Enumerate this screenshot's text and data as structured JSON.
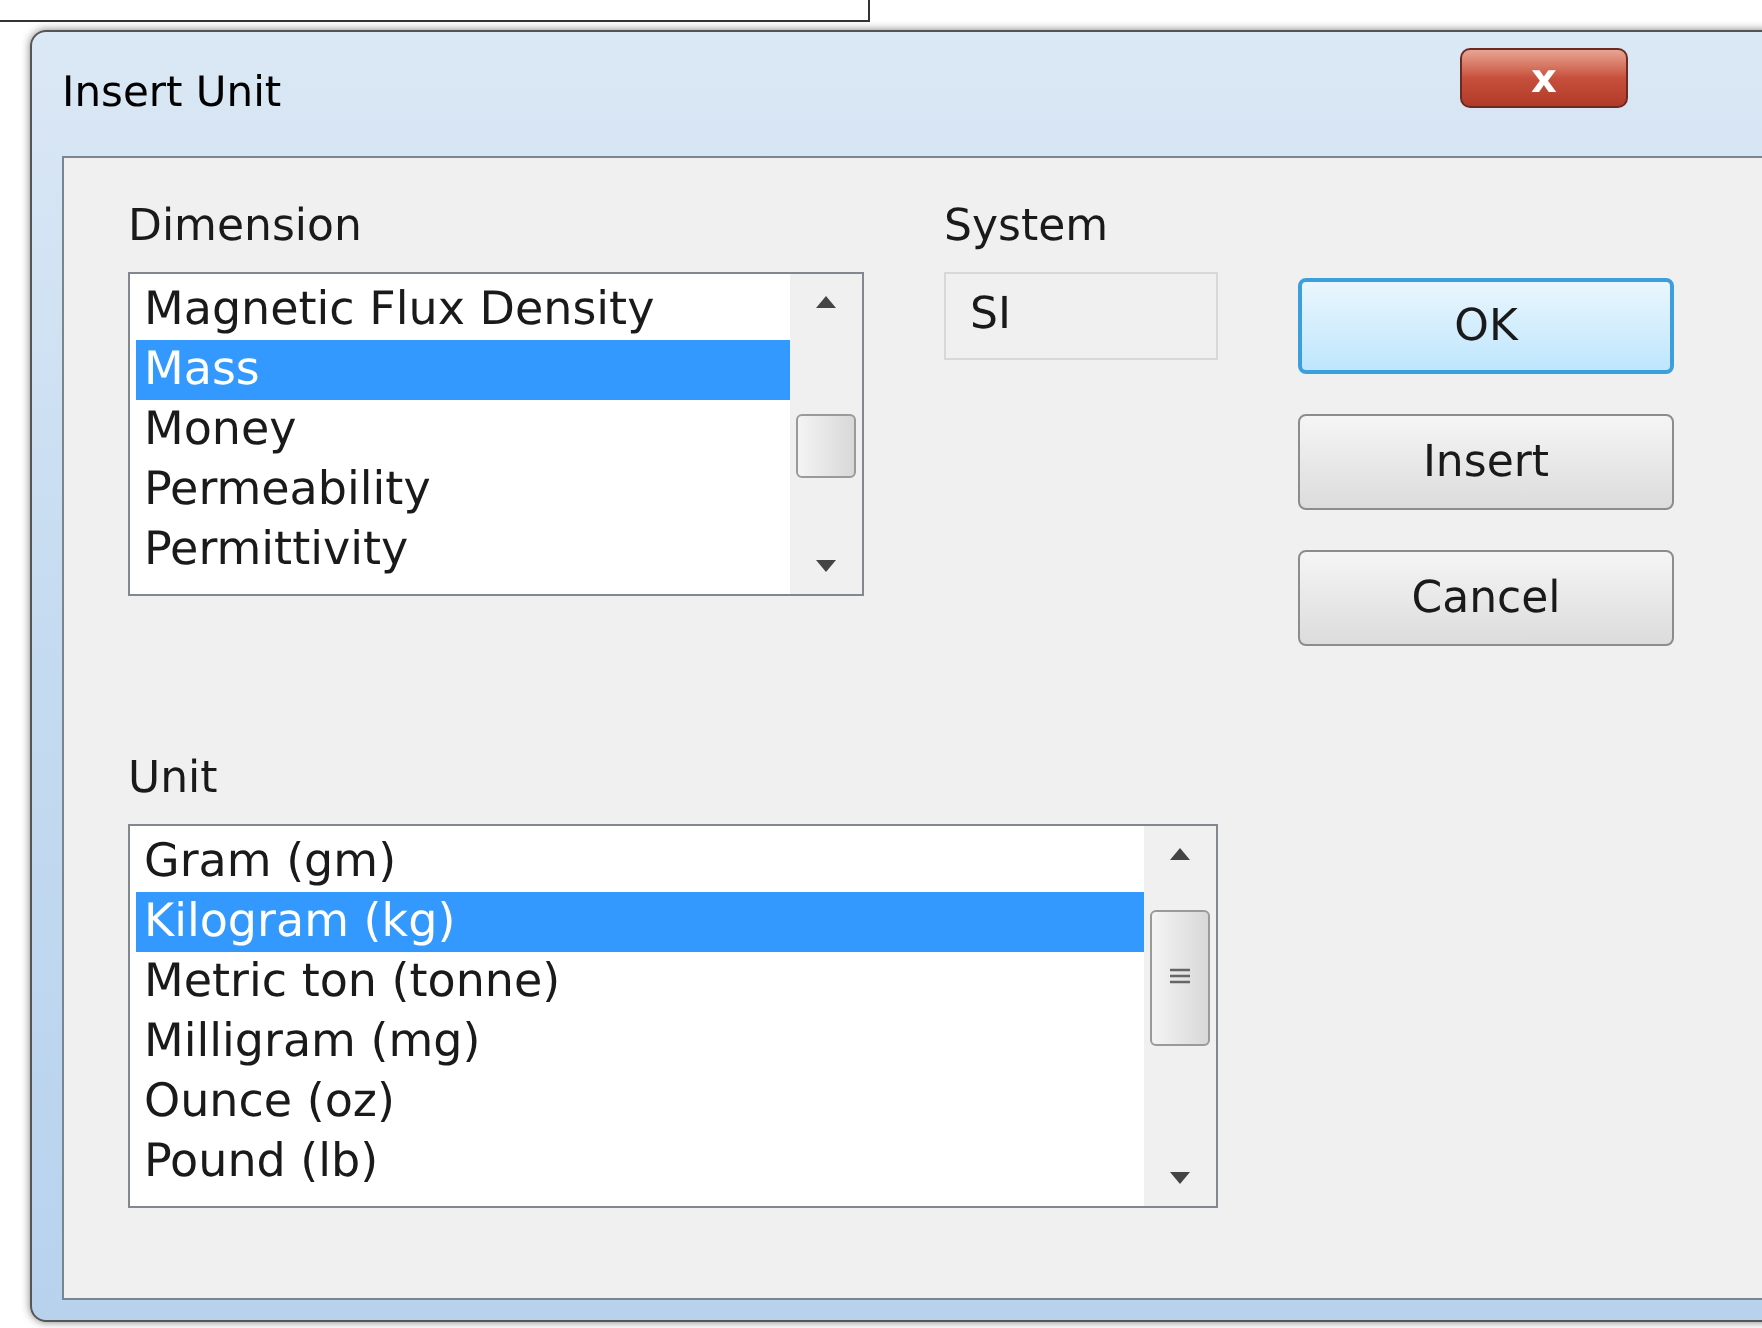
{
  "window": {
    "title": "Insert Unit",
    "close": "x"
  },
  "dimension": {
    "label": "Dimension",
    "items": [
      {
        "label": "Magnetic Flux Density",
        "selected": false
      },
      {
        "label": "Mass",
        "selected": true
      },
      {
        "label": "Money",
        "selected": false
      },
      {
        "label": "Permeability",
        "selected": false
      },
      {
        "label": "Permittivity",
        "selected": false
      }
    ]
  },
  "system": {
    "label": "System",
    "value": "SI"
  },
  "buttons": [
    {
      "label": "OK",
      "default": true
    },
    {
      "label": "Insert",
      "default": false
    },
    {
      "label": "Cancel",
      "default": false
    }
  ],
  "unit": {
    "label": "Unit",
    "items": [
      {
        "label": "Gram (gm)",
        "selected": false
      },
      {
        "label": "Kilogram (kg)",
        "selected": true
      },
      {
        "label": "Metric ton (tonne)",
        "selected": false
      },
      {
        "label": "Milligram (mg)",
        "selected": false
      },
      {
        "label": "Ounce (oz)",
        "selected": false
      },
      {
        "label": "Pound (lb)",
        "selected": false
      }
    ]
  }
}
